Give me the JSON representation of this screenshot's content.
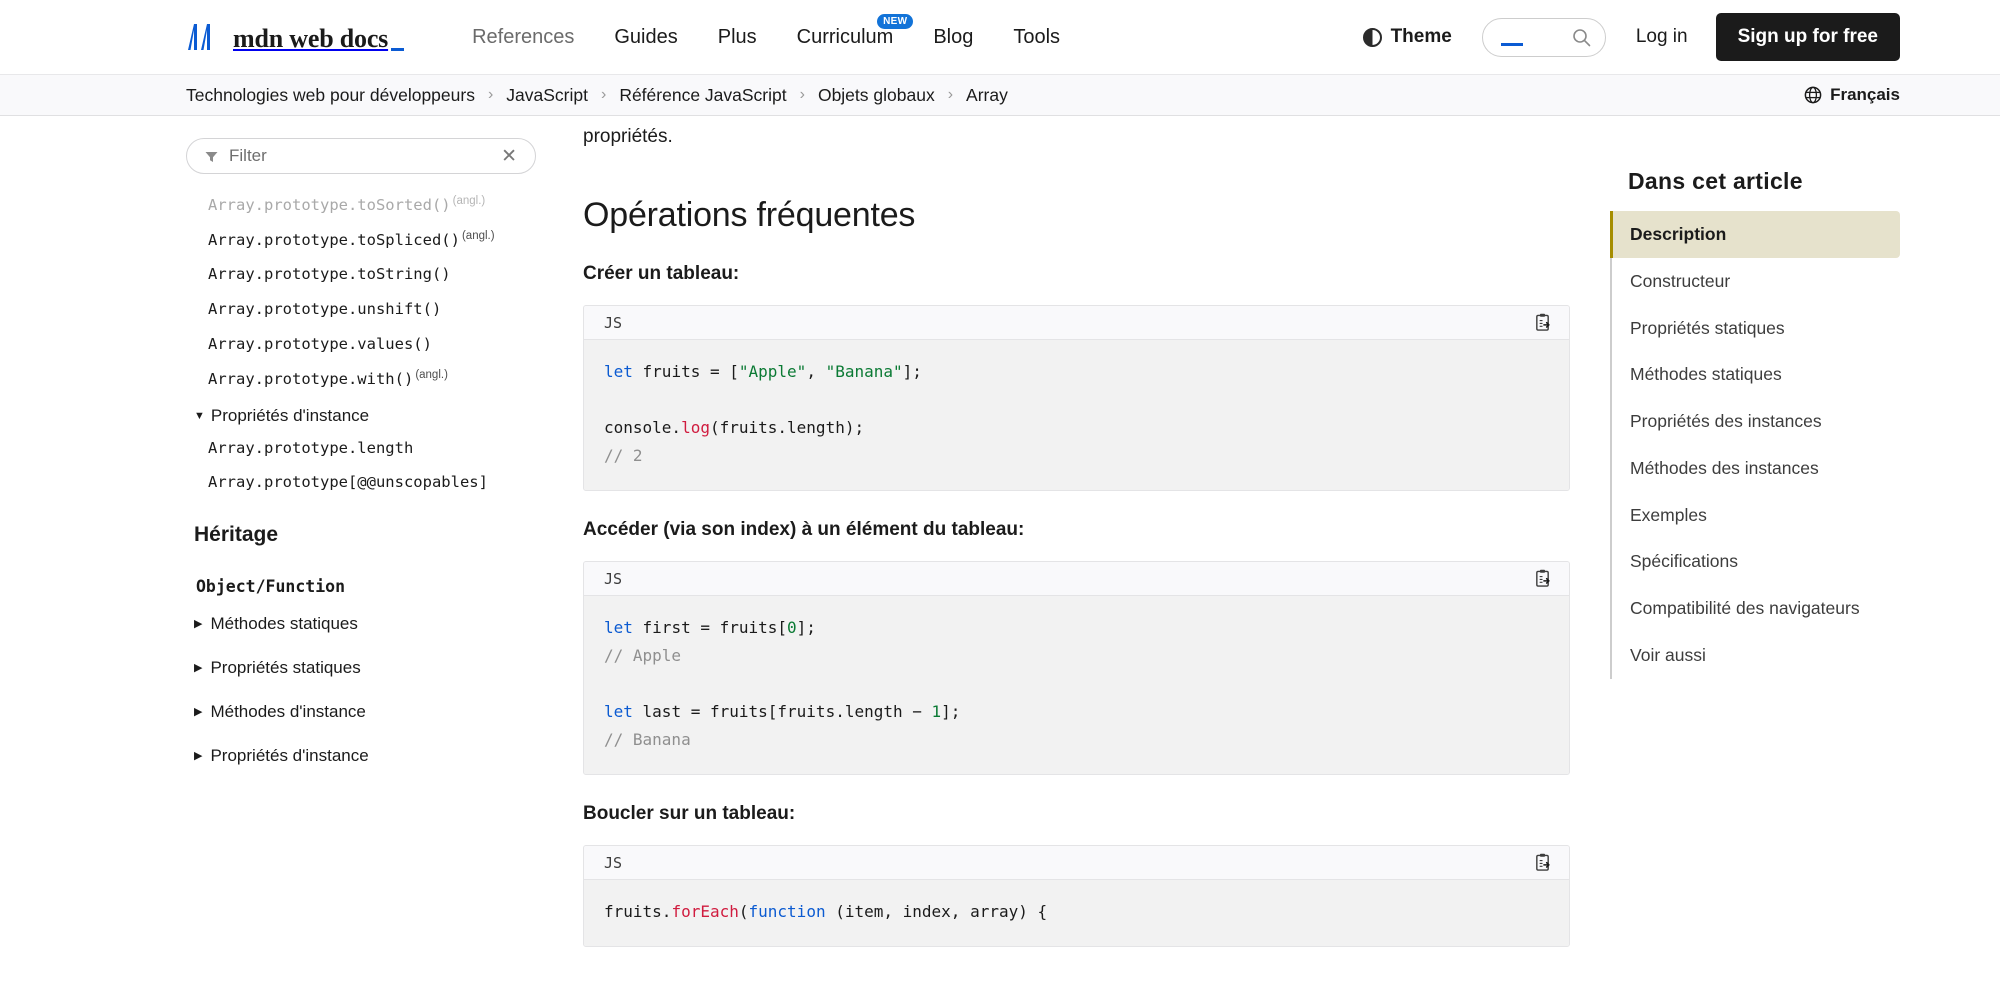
{
  "header": {
    "logo_text": "mdn web docs",
    "logo_icon": "mdn-logo-icon",
    "nav": [
      {
        "label": "References",
        "muted": true,
        "badge": ""
      },
      {
        "label": "Guides",
        "muted": false,
        "badge": ""
      },
      {
        "label": "Plus",
        "muted": false,
        "badge": ""
      },
      {
        "label": "Curriculum",
        "muted": false,
        "badge": "NEW"
      },
      {
        "label": "Blog",
        "muted": false,
        "badge": ""
      },
      {
        "label": "Tools",
        "muted": false,
        "badge": ""
      }
    ],
    "theme_label": "Theme",
    "search_placeholder": "",
    "login_label": "Log in",
    "signup_label": "Sign up for free"
  },
  "breadcrumb": {
    "separator": "›",
    "items": [
      "Technologies web pour développeurs",
      "JavaScript",
      "Référence JavaScript",
      "Objets globaux",
      "Array"
    ],
    "language_label": "Français"
  },
  "sidebar": {
    "filter_placeholder": "Filter",
    "filter_value": "",
    "clear_label": "✕",
    "items": [
      {
        "label": "Array.prototype.toSorted()",
        "sup": "(angl.)",
        "dim": true
      },
      {
        "label": "Array.prototype.toSpliced()",
        "sup": "(angl.)",
        "dim": false
      },
      {
        "label": "Array.prototype.toString()",
        "sup": "",
        "dim": false
      },
      {
        "label": "Array.prototype.unshift()",
        "sup": "",
        "dim": false
      },
      {
        "label": "Array.prototype.values()",
        "sup": "",
        "dim": false
      },
      {
        "label": "Array.prototype.with()",
        "sup": "(angl.)",
        "dim": false
      }
    ],
    "group_label": "Propriétés d'instance",
    "group_marker": "▼",
    "group_items": [
      {
        "label": "Array.prototype.length",
        "sup": "",
        "dim": false
      },
      {
        "label": "Array.prototype[@@unscopables]",
        "sup": "",
        "dim": false
      }
    ],
    "inheritance_title": "Héritage",
    "inheritance_parent": "Object/Function",
    "collapsed_marker": "▶",
    "collapsed_sections": [
      "Méthodes statiques",
      "Propriétés statiques",
      "Méthodes d'instance",
      "Propriétés d'instance"
    ]
  },
  "article": {
    "partial_text": "propriétés.",
    "section_heading": "Opérations fréquentes",
    "blocks": [
      {
        "lead": "Créer un tableau:",
        "lang": "JS",
        "copy_icon": "copy-to-clipboard-icon",
        "code_tokens": [
          [
            {
              "t": "let",
              "c": "kw"
            },
            {
              "t": " fruits = [",
              "c": ""
            },
            {
              "t": "\"Apple\"",
              "c": "str"
            },
            {
              "t": ", ",
              "c": ""
            },
            {
              "t": "\"Banana\"",
              "c": "str"
            },
            {
              "t": "];",
              "c": ""
            }
          ],
          [
            {
              "t": "",
              "c": ""
            }
          ],
          [
            {
              "t": "console.",
              "c": ""
            },
            {
              "t": "log",
              "c": "fn"
            },
            {
              "t": "(fruits.length);",
              "c": ""
            }
          ],
          [
            {
              "t": "// 2",
              "c": "cm"
            }
          ]
        ]
      },
      {
        "lead": "Accéder (via son index) à un élément du tableau:",
        "lang": "JS",
        "copy_icon": "copy-to-clipboard-icon",
        "code_tokens": [
          [
            {
              "t": "let",
              "c": "kw"
            },
            {
              "t": " first = fruits[",
              "c": ""
            },
            {
              "t": "0",
              "c": "num"
            },
            {
              "t": "];",
              "c": ""
            }
          ],
          [
            {
              "t": "// Apple",
              "c": "cm"
            }
          ],
          [
            {
              "t": "",
              "c": ""
            }
          ],
          [
            {
              "t": "let",
              "c": "kw"
            },
            {
              "t": " last = fruits[fruits.length − ",
              "c": ""
            },
            {
              "t": "1",
              "c": "num"
            },
            {
              "t": "];",
              "c": ""
            }
          ],
          [
            {
              "t": "// Banana",
              "c": "cm"
            }
          ]
        ]
      },
      {
        "lead": "Boucler sur un tableau:",
        "lang": "JS",
        "copy_icon": "copy-to-clipboard-icon",
        "code_tokens": [
          [
            {
              "t": "fruits.",
              "c": ""
            },
            {
              "t": "forEach",
              "c": "fn"
            },
            {
              "t": "(",
              "c": ""
            },
            {
              "t": "function",
              "c": "kw"
            },
            {
              "t": " (item, index, array) {",
              "c": ""
            }
          ]
        ]
      }
    ]
  },
  "toc": {
    "title": "Dans cet article",
    "items": [
      {
        "label": "Description",
        "active": true
      },
      {
        "label": "Constructeur",
        "active": false
      },
      {
        "label": "Propriétés statiques",
        "active": false
      },
      {
        "label": "Méthodes statiques",
        "active": false
      },
      {
        "label": "Propriétés des instances",
        "active": false
      },
      {
        "label": "Méthodes des instances",
        "active": false
      },
      {
        "label": "Exemples",
        "active": false
      },
      {
        "label": "Spécifications",
        "active": false
      },
      {
        "label": "Compatibilité des navigateurs",
        "active": false
      },
      {
        "label": "Voir aussi",
        "active": false
      }
    ]
  },
  "colors": {
    "accent_blue": "#0b5bd3",
    "badge_blue": "#1273d8",
    "toc_active_bg": "#e6e2cc",
    "toc_active_border": "#a58d00",
    "code_bg": "#f2f2f2",
    "crumbbar_bg": "#f9f9fb"
  }
}
